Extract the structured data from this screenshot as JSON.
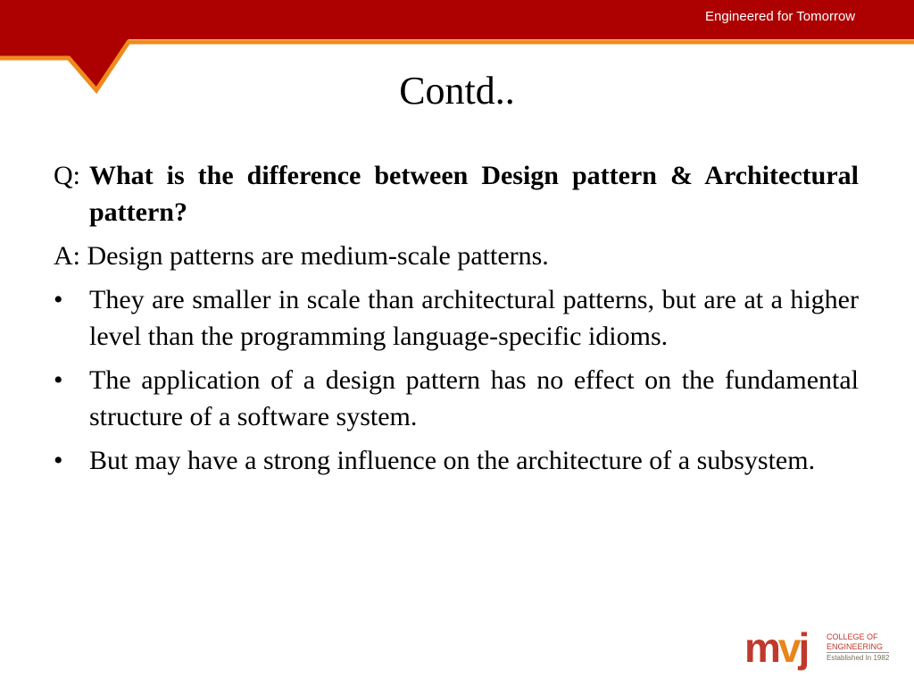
{
  "header": {
    "tagline": "Engineered for Tomorrow",
    "colors": {
      "band": "#ad0000",
      "accent": "#ef8a1e"
    }
  },
  "slide": {
    "title": "Contd..",
    "question": {
      "prefix": "Q:",
      "text": "What is the difference between Design pattern & Architectural pattern?"
    },
    "answer": "A: Design patterns are medium-scale patterns.",
    "bullets": [
      "They are smaller in scale than architectural patterns, but are at a higher level than the programming language-specific idioms.",
      "The application of a design pattern has no effect on the fundamental structure of a software system.",
      "But may have a strong influence on the architecture of a subsystem."
    ],
    "bullet_glyph": "•"
  },
  "logo": {
    "mark_m": "m",
    "mark_v": "v",
    "mark_j": "j",
    "line1": "COLLEGE OF",
    "line2": "ENGINEERING",
    "line3": "Established In 1982"
  }
}
